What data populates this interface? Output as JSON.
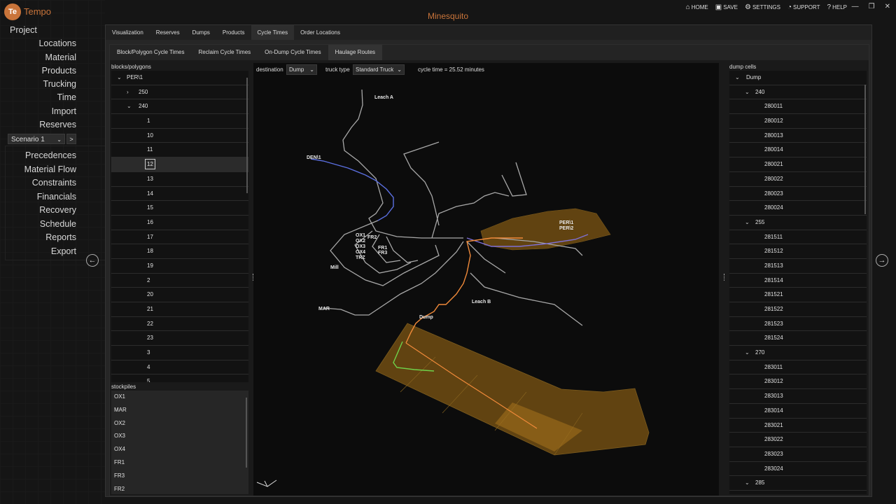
{
  "app": {
    "logo": "Te",
    "name": "Tempo",
    "project": "Minesquito"
  },
  "topnav": [
    {
      "label": "HOME",
      "icon": "⌂"
    },
    {
      "label": "SAVE",
      "icon": "▣"
    },
    {
      "label": "SETTINGS",
      "icon": "⚙"
    },
    {
      "label": "SUPPORT",
      "icon": "◔"
    },
    {
      "label": "HELP",
      "icon": "?"
    }
  ],
  "window_controls": [
    "—",
    "❐",
    "✕"
  ],
  "sidebar": {
    "project": "Project",
    "items": [
      "Locations",
      "Material",
      "Products",
      "Trucking",
      "Time",
      "Import",
      "Reserves"
    ],
    "scenario": "Scenario 1",
    "scenario_go": ">",
    "sub_items": [
      "Precedences",
      "Material Flow",
      "Constraints",
      "Financials",
      "Recovery",
      "Schedule",
      "Reports",
      "Export"
    ]
  },
  "tabs": [
    "Visualization",
    "Reserves",
    "Dumps",
    "Products",
    "Cycle Times",
    "Order Locations"
  ],
  "active_tab": "Cycle Times",
  "subtabs": [
    "Block/Polygon Cycle Times",
    "Reclaim Cycle Times",
    "On-Dump Cycle Times",
    "Haulage Routes"
  ],
  "active_subtab": "Haulage Routes",
  "blocks": {
    "label": "blocks/polygons",
    "root": "PER\\1",
    "groups": [
      {
        "name": "250",
        "expanded": false
      },
      {
        "name": "240",
        "expanded": true
      }
    ],
    "items": [
      "1",
      "10",
      "11",
      "12",
      "13",
      "14",
      "15",
      "16",
      "17",
      "18",
      "19",
      "2",
      "20",
      "21",
      "22",
      "23",
      "3",
      "4",
      "5"
    ],
    "selected": "12"
  },
  "stockpiles": {
    "label": "stockpiles",
    "items": [
      "OX1",
      "MAR",
      "OX2",
      "OX3",
      "OX4",
      "FR1",
      "FR3",
      "FR2"
    ]
  },
  "controls": {
    "destination_label": "destination",
    "destination_value": "Dump",
    "truck_label": "truck type",
    "truck_value": "Standard Truck",
    "cycle_time": "cycle time = 25.52 minutes"
  },
  "map_labels": {
    "leach_a": "Leach A",
    "den": "DEN\\1",
    "per1": "PER\\1",
    "per2": "PER\\2",
    "ox1": "OX1",
    "ox2": "OX2",
    "ox3": "OX3",
    "ox4": "OX4",
    "trz": "TRZ",
    "fr2": "FR2",
    "fr1": "FR1",
    "fr3": "FR3",
    "mill": "Mill",
    "mar": "MAR",
    "leach_b": "Leach B",
    "dump": "Dump"
  },
  "dump_cells": {
    "label": "dump cells",
    "root": "Dump",
    "groups": [
      {
        "name": "240",
        "cells": [
          "280011",
          "280012",
          "280013",
          "280014",
          "280021",
          "280022",
          "280023",
          "280024"
        ]
      },
      {
        "name": "255",
        "cells": [
          "281511",
          "281512",
          "281513",
          "281514",
          "281521",
          "281522",
          "281523",
          "281524"
        ]
      },
      {
        "name": "270",
        "cells": [
          "283011",
          "283012",
          "283013",
          "283014",
          "283021",
          "283022",
          "283023",
          "283024"
        ]
      },
      {
        "name": "285",
        "cells": []
      }
    ]
  },
  "colors": {
    "accent": "#c9743a",
    "route_blue": "#5b6fe0",
    "route_orange": "#f08a3a",
    "route_green": "#6fd24a",
    "dump_fill": "#6b4a12"
  }
}
